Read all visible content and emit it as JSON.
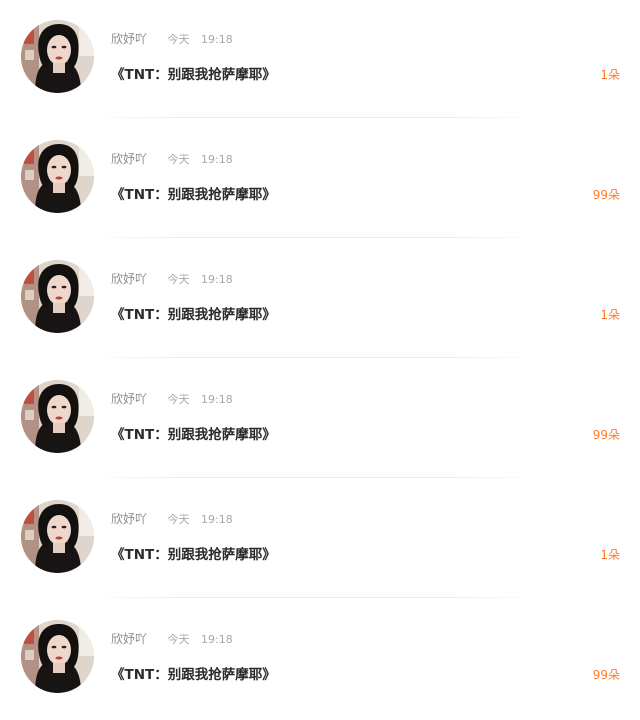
{
  "colors": {
    "background": "#ffffff",
    "username": "#8f8f8f",
    "timestamp": "#a8a8a8",
    "title": "#2a2a2a",
    "gift_count": "#ff7a2f",
    "divider": "#ebebeb"
  },
  "feed": {
    "items": [
      {
        "username": "欣妤吖",
        "day": "今天",
        "time": "19:18",
        "title": "《TNT：别跟我抢萨摩耶》",
        "gift_count": "1朵",
        "avatar_icon": "user-avatar-photo"
      },
      {
        "username": "欣妤吖",
        "day": "今天",
        "time": "19:18",
        "title": "《TNT：别跟我抢萨摩耶》",
        "gift_count": "99朵",
        "avatar_icon": "user-avatar-photo"
      },
      {
        "username": "欣妤吖",
        "day": "今天",
        "time": "19:18",
        "title": "《TNT：别跟我抢萨摩耶》",
        "gift_count": "1朵",
        "avatar_icon": "user-avatar-photo"
      },
      {
        "username": "欣妤吖",
        "day": "今天",
        "time": "19:18",
        "title": "《TNT：别跟我抢萨摩耶》",
        "gift_count": "99朵",
        "avatar_icon": "user-avatar-photo"
      },
      {
        "username": "欣妤吖",
        "day": "今天",
        "time": "19:18",
        "title": "《TNT：别跟我抢萨摩耶》",
        "gift_count": "1朵",
        "avatar_icon": "user-avatar-photo"
      },
      {
        "username": "欣妤吖",
        "day": "今天",
        "time": "19:18",
        "title": "《TNT：别跟我抢萨摩耶》",
        "gift_count": "99朵",
        "avatar_icon": "user-avatar-photo"
      }
    ]
  }
}
